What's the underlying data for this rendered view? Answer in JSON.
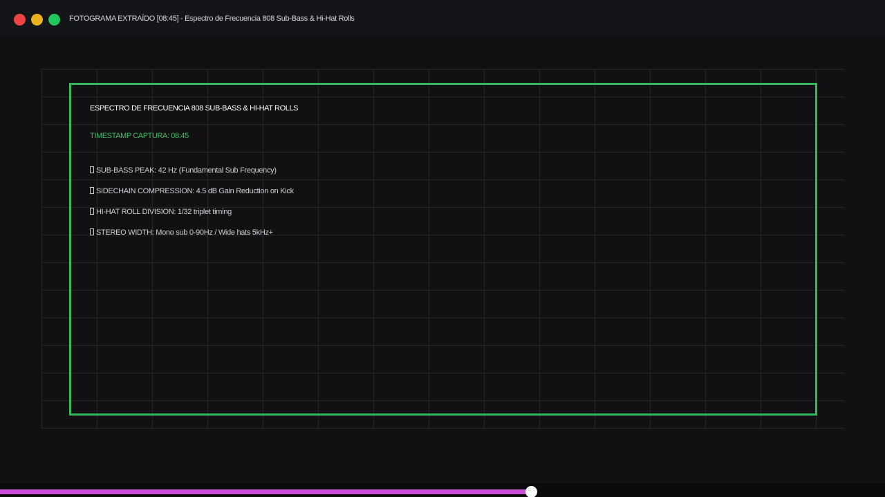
{
  "window": {
    "title": "FOTOGRAMA EXTRAÍDO [08:45] - Espectro de Frecuencia 808 Sub-Bass & Hi-Hat Rolls"
  },
  "panel": {
    "title": "ESPECTRO DE FRECUENCIA 808 SUB-BASS & HI-HAT ROLLS",
    "timestamp": "TIMESTAMP CAPTURA: 08:45",
    "metrics": [
      "SUB-BASS PEAK: 42 Hz (Fundamental Sub Frequency)",
      "SIDECHAIN COMPRESSION: 4.5 dB Gain Reduction on Kick",
      "HI-HAT ROLL DIVISION: 1/32 triplet timing",
      "STEREO WIDTH: Mono sub 0-90Hz / Wide hats 5kHz+"
    ]
  },
  "playback": {
    "progress_percent": 60
  },
  "colors": {
    "accent_green": "#33b95c",
    "timestamp_green": "#3fbf62",
    "progress_magenta": "#c84ed6",
    "close": "#ee4444",
    "minimize": "#eab21d",
    "maximize": "#22c55e"
  }
}
